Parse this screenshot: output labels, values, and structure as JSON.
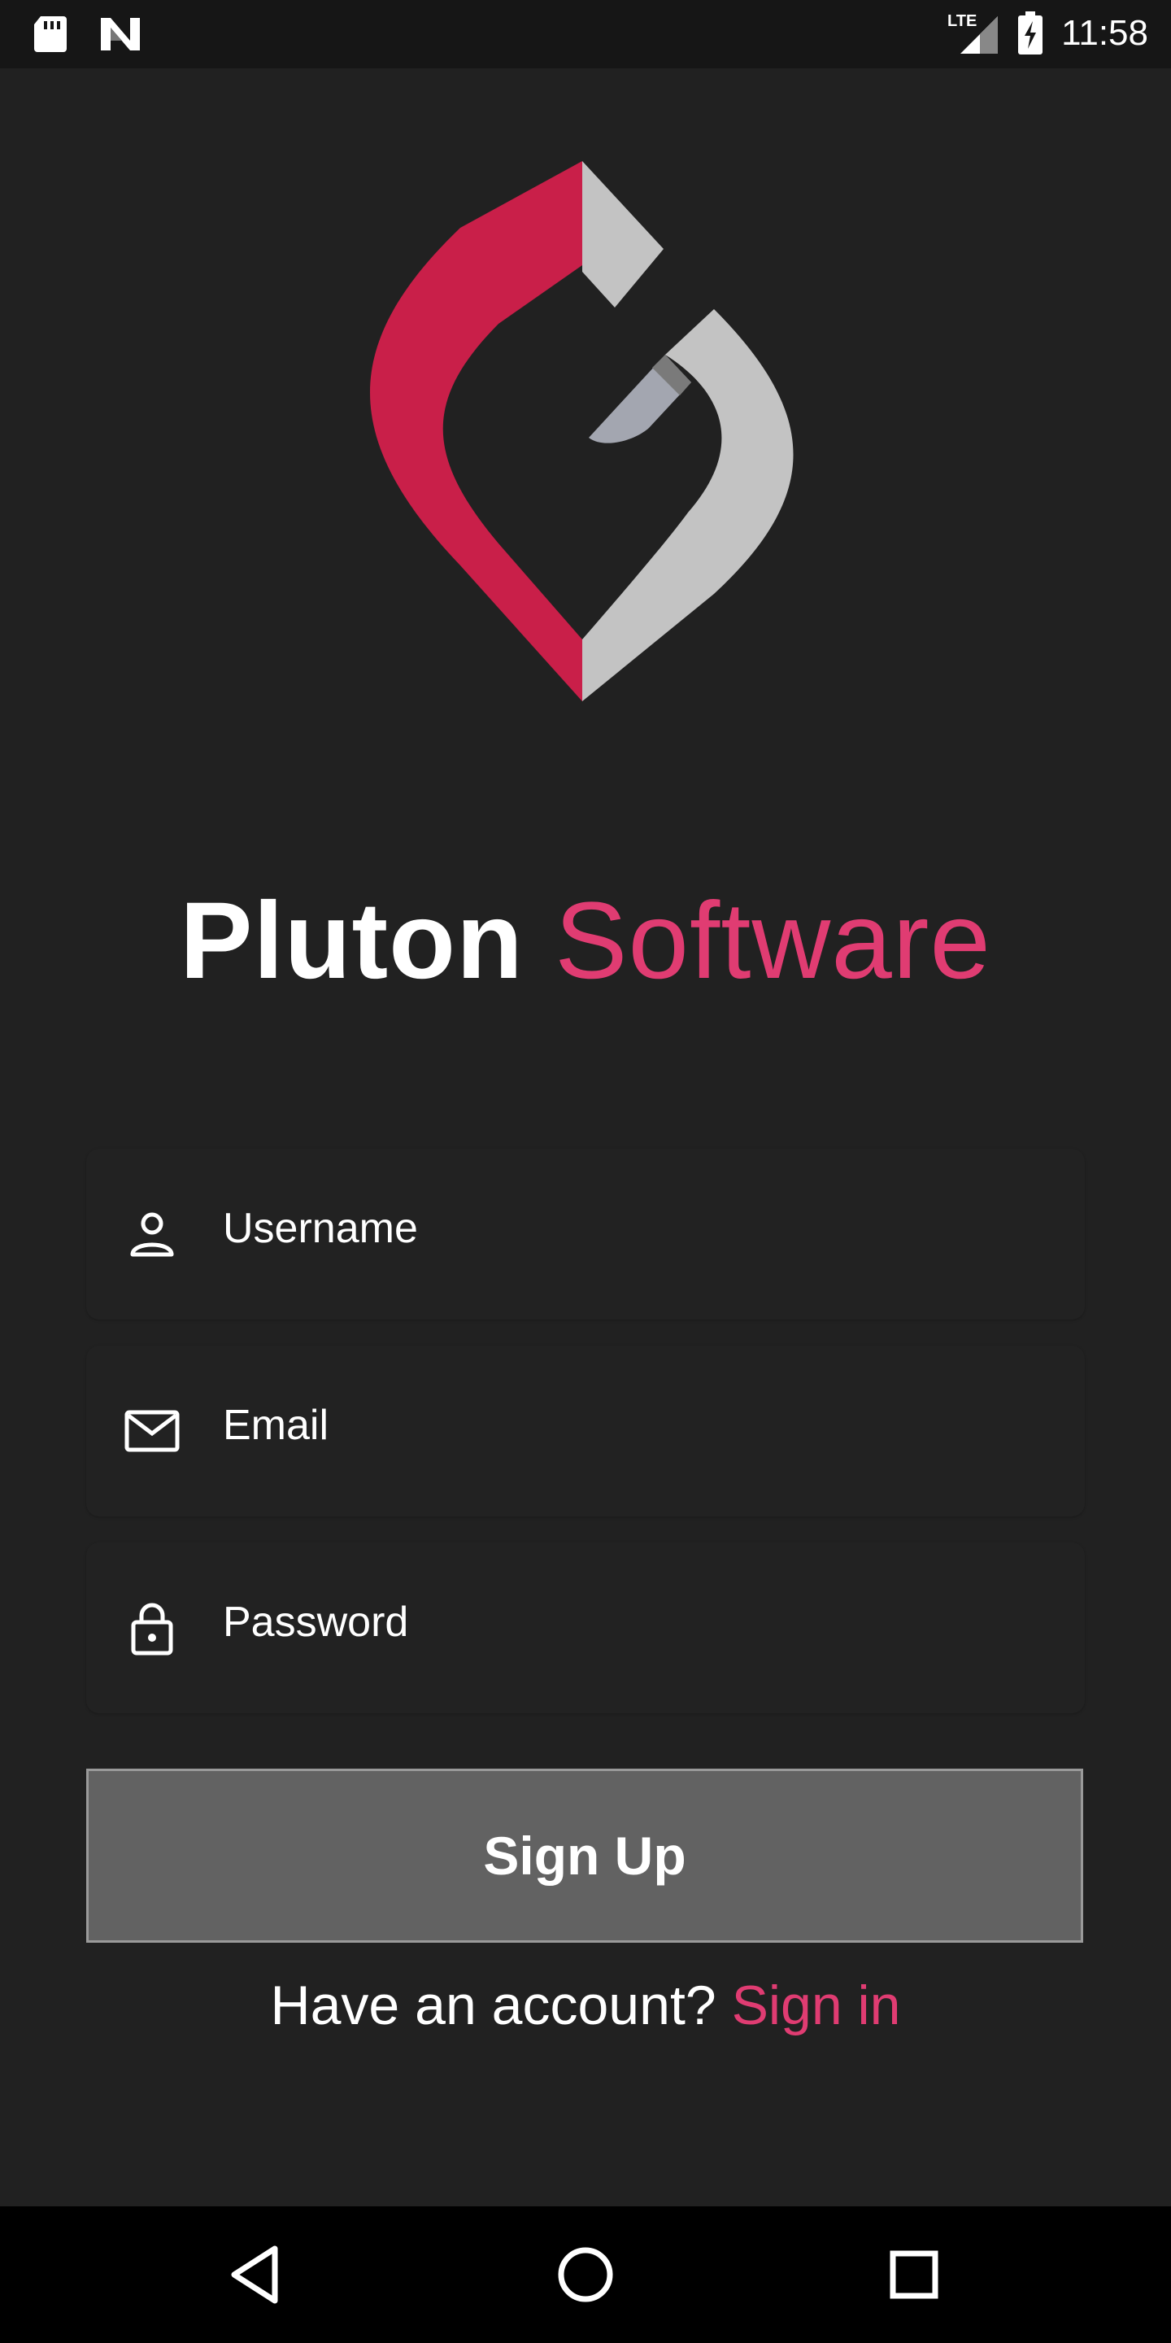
{
  "status_bar": {
    "time": "11:58",
    "network": "LTE",
    "left_icons": [
      "sd-card-icon",
      "n-notification-icon"
    ],
    "right_icons": [
      "signal-icon",
      "battery-charging-icon"
    ]
  },
  "brand": {
    "name_part1": "Pluton",
    "name_part2": "Software"
  },
  "form": {
    "username_placeholder": "Username",
    "email_placeholder": "Email",
    "password_placeholder": "Password",
    "submit_label": "Sign Up"
  },
  "footer": {
    "prompt": "Have an account?",
    "signin_link": "Sign in"
  },
  "colors": {
    "background": "#212121",
    "accent": "#E03C72",
    "logo_red": "#C91F49",
    "logo_gray": "#C3C3C3",
    "button": "#626262"
  }
}
